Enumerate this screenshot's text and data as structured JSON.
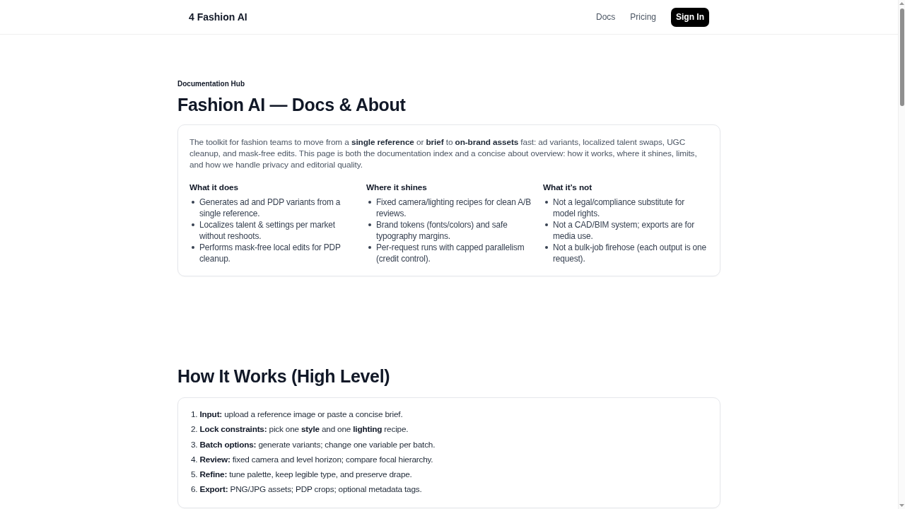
{
  "header": {
    "logo": "4 Fashion AI",
    "nav": [
      {
        "label": "Docs"
      },
      {
        "label": "Pricing"
      }
    ],
    "sign_in_button": "Sign In"
  },
  "hero": {
    "eyebrow": "Documentation Hub",
    "title": "Fashion AI — Docs & About"
  },
  "about_card": {
    "intro": "The toolkit for fashion teams to move from a **single reference** or **brief** to **on-brand assets** fast: ad variants, localized talent swaps, UGC cleanup, and mask-free edits. This page is both the documentation index and a concise about overview: how it works, where it shines, limits, and how we handle privacy and editorial quality.",
    "columns": [
      {
        "heading": "What it does",
        "items": [
          "Generates ad and PDP variants from a single reference.",
          "Localizes talent & settings per market without reshoots.",
          "Performs mask-free local edits for PDP cleanup."
        ]
      },
      {
        "heading": "Where it shines",
        "items": [
          "Fixed camera/lighting recipes for clean A/B reviews.",
          "Brand tokens (fonts/colors) and safe typography margins.",
          "Per-request runs with capped parallelism (credit control)."
        ]
      },
      {
        "heading": "What it’s not",
        "items": [
          "Not a legal/compliance substitute for model rights.",
          "Not a CAD/BIM system; exports are for media use.",
          "Not a bulk-job firehose (each output is one request)."
        ]
      }
    ]
  },
  "how_it_works": {
    "title": "How It Works (High Level)",
    "steps": [
      "1. **Input:** upload a reference image or paste a concise brief.",
      "2. **Lock constraints:** pick one **style** and one **lighting** recipe.",
      "3. **Batch options:** generate variants; change one variable per batch.",
      "4. **Review:** fixed camera and level horizon; compare focal hierarchy.",
      "5. **Refine:** tune palette, keep legible type, and preserve drape.",
      "6. **Export:** PNG/JPG assets; PDP crops; optional metadata tags."
    ]
  }
}
